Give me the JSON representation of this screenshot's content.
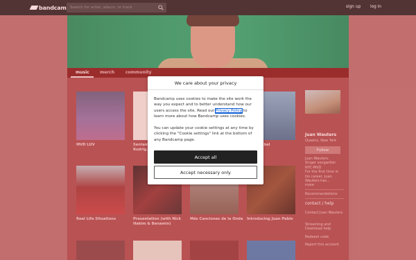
{
  "header": {
    "logo_text": "bandcamp",
    "search_placeholder": "Search for artist, album, or track",
    "search_icon": "search-icon",
    "signup_label": "sign up",
    "login_label": "log in"
  },
  "nav": {
    "tabs": [
      {
        "label": "music",
        "active": true
      },
      {
        "label": "merch",
        "active": false
      },
      {
        "label": "community",
        "active": false
      }
    ]
  },
  "albums": [
    {
      "title": "MVD LUV"
    },
    {
      "title": "Sentamos ... (with N... Rodrig..."
    },
    {
      "title": ""
    },
    {
      "title": "...ing Rebel"
    },
    {
      "title": "Real Life Situations"
    },
    {
      "title": "Presentation (with Nick Hakim & Benamin)"
    },
    {
      "title": "Más Canciones de la Onda"
    },
    {
      "title": "Introducing Juan Pablo"
    }
  ],
  "sidebar": {
    "artist_name": "Juan Wauters",
    "location": "Queens, New York",
    "follow_label": "Follow",
    "bio": [
      "Juan Wauters:",
      "Singer songwriter",
      "NYC-MVD",
      "For the first time in",
      "his career, Juan",
      "Wauters has..."
    ],
    "more_label": "more",
    "recommendations_label": "Recommendations",
    "contact_heading": "contact / help",
    "links": [
      "Contact Juan Wauters",
      "Streaming and Download help",
      "Redeem code",
      "Report this account"
    ]
  },
  "privacy_modal": {
    "title": "We care about your privacy",
    "body_before_link": "Bandcamp uses cookies to make the site work the way you expect and to better understand how our users access the site. Read our ",
    "link_text": "Privacy Policy",
    "body_after_link": " to learn more about how Bandcamp uses cookies.",
    "settings_text": "You can update your cookie settings at any time by clicking the \"Cookie settings\" link at the bottom of any Bandcamp page.",
    "accept_all_label": "Accept all",
    "accept_necessary_label": "Accept necessary only"
  },
  "colors": {
    "page_bg": "#b56b6b",
    "content_bg": "#a84546",
    "nav_bg": "#7d1110",
    "topbar_bg": "#1b1b1b",
    "link_blue": "#0a5bd6"
  }
}
